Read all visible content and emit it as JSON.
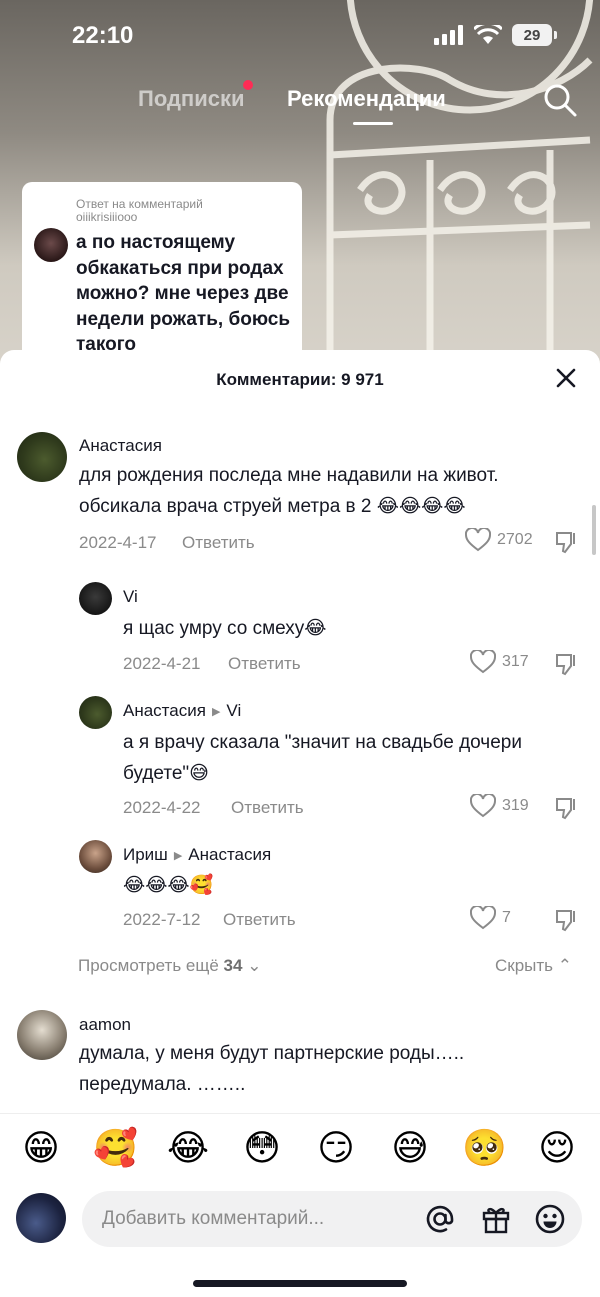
{
  "status_bar": {
    "time": "22:10",
    "battery": "29"
  },
  "top_tabs": {
    "following": "Подписки",
    "recommended": "Рекомендации"
  },
  "reply_card": {
    "meta_line1": "Ответ на комментарий",
    "meta_line2": "oiiikrisiiiooo",
    "text": "а по настоящему обкакаться при родах можно? мне через две недели рожать, боюсь такого"
  },
  "sheet": {
    "title": "Комментарии: 9 971",
    "more_replies_prefix": "Просмотреть ещё",
    "more_replies_count": "34",
    "hide_label": "Скрыть"
  },
  "comments": [
    {
      "author": "Анастасия",
      "text": "для рождения последа мне надавили на живот. обсикала врача струей метра в 2 😂😂😂😂",
      "date": "2022-4-17",
      "reply_label": "Ответить",
      "likes": "2702"
    },
    {
      "author": "Vi",
      "text": "я щас умру со смеху😂",
      "date": "2022-4-21",
      "reply_label": "Ответить",
      "likes": "317"
    },
    {
      "author": "Анастасия",
      "reply_to": "Vi",
      "text": "а я врачу сказала \"значит на свадьбе дочери будете\"😅",
      "date": "2022-4-22",
      "reply_label": "Ответить",
      "likes": "319"
    },
    {
      "author": "Ириш",
      "reply_to": "Анастасия",
      "text": "😂😂😂🥰",
      "date": "2022-7-12",
      "reply_label": "Ответить",
      "likes": "7"
    },
    {
      "author": "aamon",
      "text": "думала, у меня будут партнерские роды….. передумала. ……..",
      "date": "",
      "reply_label": "",
      "likes": ""
    }
  ],
  "emoji_bar": [
    "😁",
    "🥰",
    "😂",
    "😳",
    "😏",
    "😅",
    "🥺",
    "😌"
  ],
  "input": {
    "placeholder": "Добавить комментарий..."
  },
  "icons": {
    "search": "search-icon",
    "close": "close-icon",
    "like": "heart-icon",
    "dislike": "dislike-icon",
    "mention": "at-icon",
    "gift": "gift-icon",
    "emoji": "emoji-icon"
  },
  "colors": {
    "notification_dot": "#fe2c55",
    "text_primary": "#161823",
    "text_secondary": "#8a8a8a"
  }
}
